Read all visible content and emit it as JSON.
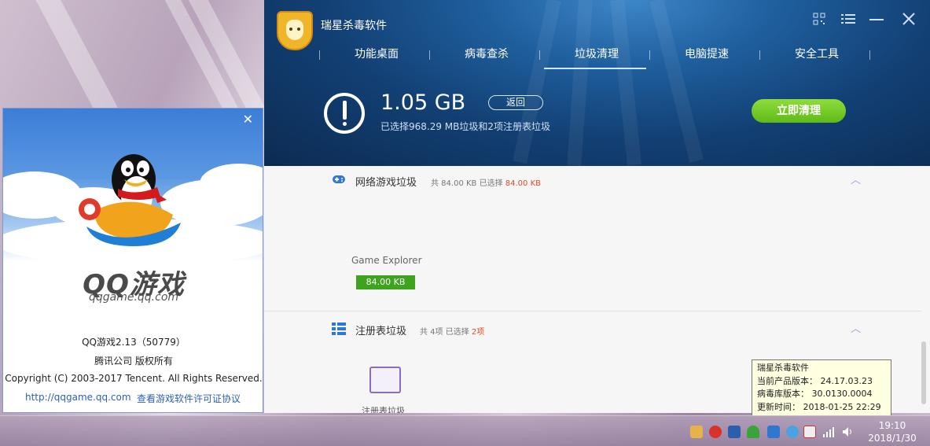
{
  "qq_window": {
    "close": "✕",
    "logo": "QQ游戏",
    "domain": "qqgame.qq.com",
    "version": "QQ游戏2.13（50779）",
    "company": "腾讯公司 版权所有",
    "copyright": "Copyright (C) 2003-2017 Tencent. All Rights Reserved.",
    "link_url": "http://qqgame.qq.com",
    "link_license": "查看游戏软件许可证协议"
  },
  "av_window": {
    "title": "瑞星杀毒软件",
    "nav": [
      "功能桌面",
      "病毒查杀",
      "垃圾清理",
      "电脑提速",
      "安全工具"
    ],
    "active_nav": "垃圾清理",
    "size": "1.05 GB",
    "back": "返回",
    "summary": "已选择968.29 MB垃圾和2项注册表垃圾",
    "clean_now": "立即清理",
    "sections": [
      {
        "title": "网络游戏垃圾",
        "meta_prefix": "共 84.00 KB 已选择 ",
        "meta_selected": "84.00 KB",
        "meta_suffix": ""
      },
      {
        "title": "注册表垃圾",
        "meta_prefix": "共 4项 已选择 ",
        "meta_selected": "2",
        "meta_suffix": "项"
      }
    ],
    "game_item": {
      "label": "Game Explorer",
      "size": "84.00 KB"
    },
    "reg_item": {
      "label": "注册表垃圾"
    }
  },
  "tooltip": {
    "line1": "瑞星杀毒软件",
    "line2": "当前产品版本： 24.17.03.23",
    "line3": "病毒库版本： 30.0130.0004",
    "line4": "更新时间： 2018-01-25 22:29"
  },
  "taskbar": {
    "time": "19:10",
    "date": "2018/1/30"
  },
  "colors": {
    "accent_green": "#5fba18",
    "header_blue": "#123f73",
    "highlight_red": "#e04b2a"
  }
}
